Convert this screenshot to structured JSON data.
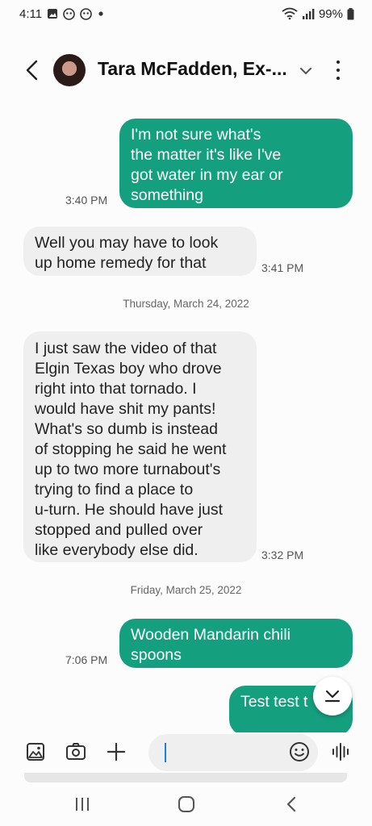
{
  "status_bar": {
    "time": "4:11",
    "battery": "99%",
    "icons": [
      "gallery-icon",
      "app-icon",
      "app-icon",
      "dot-icon",
      "wifi-icon",
      "signal-icon",
      "battery-icon"
    ]
  },
  "header": {
    "contact_name": "Tara McFadden, Ex-...",
    "icons": [
      "back-arrow-icon",
      "avatar",
      "chevron-down-icon",
      "more-vert-icon"
    ]
  },
  "messages": [
    {
      "direction": "outgoing",
      "lines": [
        "I'm not sure what's",
        "the matter it's like I've",
        "got water in my ear or",
        "something"
      ],
      "time": "3:40 PM"
    },
    {
      "direction": "incoming",
      "lines": [
        "Well you may have to look",
        "up home remedy for that"
      ],
      "time": "3:41 PM"
    },
    {
      "direction": "incoming",
      "lines": [
        "I just saw the video of that",
        "Elgin Texas boy who drove",
        "right into that tornado. I",
        "would have shit my pants!",
        "What's so dumb is instead",
        "of stopping he said he went",
        "up to two more turnabout's",
        "trying to find a place to",
        "u-turn. He should have just",
        "stopped and pulled over",
        "like everybody else did."
      ],
      "time": "3:32 PM"
    },
    {
      "direction": "outgoing",
      "lines": [
        "Wooden Mandarin chili",
        "spoons"
      ],
      "time": "7:06 PM"
    },
    {
      "direction": "outgoing",
      "lines": [
        "Test test t"
      ],
      "time": ""
    }
  ],
  "date_separators": [
    "Thursday, March 24, 2022",
    "Friday, March 25, 2022"
  ],
  "compose": {
    "placeholder": "",
    "icons": [
      "gallery-icon",
      "camera-icon",
      "plus-icon",
      "emoji-icon",
      "voice-icon"
    ]
  },
  "nav_bar": {
    "icons": [
      "recents-icon",
      "home-icon",
      "back-icon"
    ]
  },
  "colors": {
    "outgoing_bubble": "#14a07e",
    "incoming_bubble": "#efefef",
    "accent_cursor": "#1c7fe0"
  }
}
